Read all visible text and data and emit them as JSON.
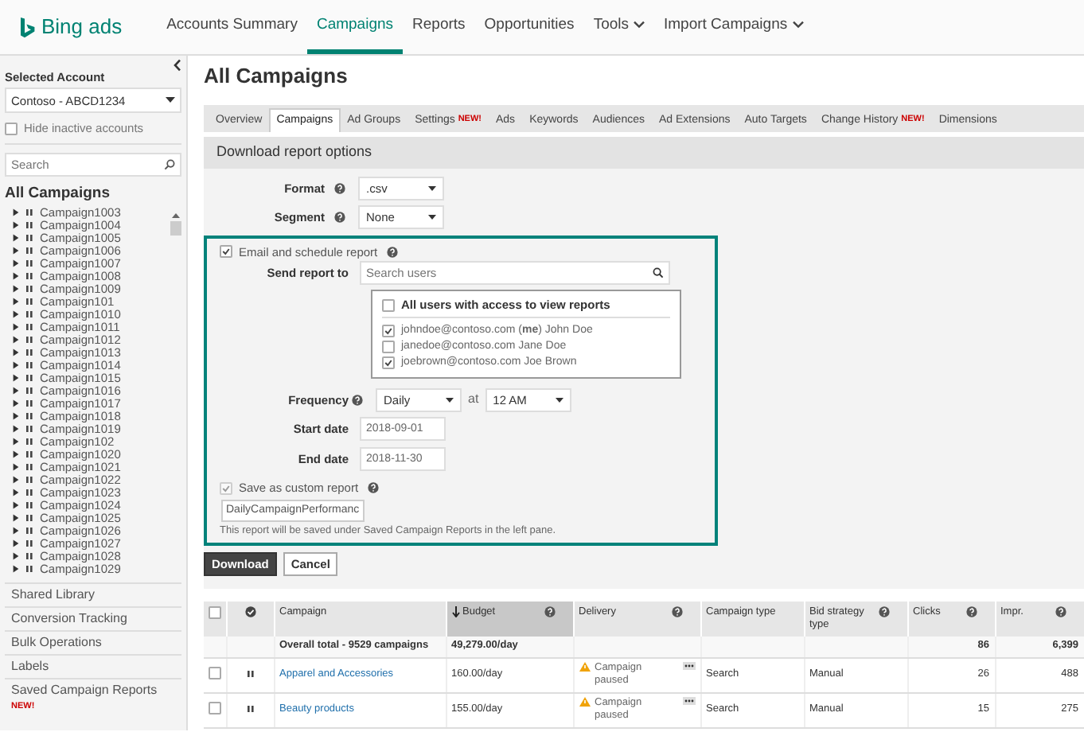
{
  "top_nav": {
    "logo": "Bing ads",
    "items": [
      {
        "label": "Accounts Summary",
        "selected": false,
        "dropdown": false
      },
      {
        "label": "Campaigns",
        "selected": true,
        "dropdown": false
      },
      {
        "label": "Reports",
        "selected": false,
        "dropdown": false
      },
      {
        "label": "Opportunities",
        "selected": false,
        "dropdown": false
      },
      {
        "label": "Tools",
        "selected": false,
        "dropdown": true
      },
      {
        "label": "Import Campaigns",
        "selected": false,
        "dropdown": true
      }
    ]
  },
  "sidebar": {
    "account_label": "Selected Account",
    "account": "Contoso - ABCD1234",
    "hide_inactive": {
      "label": "Hide inactive accounts",
      "checked": false
    },
    "search": {
      "placeholder": "Search"
    },
    "tree_title": "All Campaigns",
    "campaigns": [
      "Campaign1003",
      "Campaign1004",
      "Campaign1005",
      "Campaign1006",
      "Campaign1007",
      "Campaign1008",
      "Campaign1009",
      "Campaign101",
      "Campaign1010",
      "Campaign1011",
      "Campaign1012",
      "Campaign1013",
      "Campaign1014",
      "Campaign1015",
      "Campaign1016",
      "Campaign1017",
      "Campaign1018",
      "Campaign1019",
      "Campaign102",
      "Campaign1020",
      "Campaign1021",
      "Campaign1022",
      "Campaign1023",
      "Campaign1024",
      "Campaign1025",
      "Campaign1026",
      "Campaign1027",
      "Campaign1028",
      "Campaign1029"
    ],
    "links": [
      {
        "label": "Shared Library"
      },
      {
        "label": "Conversion Tracking"
      },
      {
        "label": "Bulk Operations"
      },
      {
        "label": "Labels"
      },
      {
        "label": "Saved Campaign Reports",
        "badge": "NEW!"
      }
    ]
  },
  "page_title": "All Campaigns",
  "tabs": [
    {
      "label": "Overview",
      "selected": false
    },
    {
      "label": "Campaigns",
      "selected": true
    },
    {
      "label": "Ad Groups",
      "selected": false
    },
    {
      "label": "Settings",
      "selected": false,
      "badge": "NEW!"
    },
    {
      "label": "Ads",
      "selected": false
    },
    {
      "label": "Keywords",
      "selected": false
    },
    {
      "label": "Audiences",
      "selected": false
    },
    {
      "label": "Ad Extensions",
      "selected": false
    },
    {
      "label": "Auto Targets",
      "selected": false
    },
    {
      "label": "Change History",
      "selected": false,
      "badge": "NEW!"
    },
    {
      "label": "Dimensions",
      "selected": false
    }
  ],
  "report": {
    "title": "Download report options",
    "format": {
      "label": "Format",
      "value": ".csv"
    },
    "segment": {
      "label": "Segment",
      "value": "None"
    },
    "email": {
      "label": "Email and schedule report",
      "checked": true,
      "send_to_label": "Send report to",
      "search_placeholder": "Search users",
      "all_users": {
        "label": "All users with access to view reports",
        "checked": false
      },
      "users": [
        {
          "text": "johndoe@contoso.com (**me**) John Doe",
          "checked": true
        },
        {
          "text": "janedoe@contoso.com Jane Doe",
          "checked": false
        },
        {
          "text": "joebrown@contoso.com Joe Brown",
          "checked": true
        }
      ],
      "frequency": {
        "label": "Frequency",
        "value": "Daily",
        "at": "at",
        "time": "12 AM"
      },
      "start_date": {
        "label": "Start date",
        "value": "2018-09-01"
      },
      "end_date": {
        "label": "End date",
        "value": "2018-11-30"
      },
      "save_custom": {
        "label": "Save as custom report",
        "checked": true,
        "disabled": true,
        "name": "DailyCampaignPerformanc",
        "note": "This report will be saved under Saved Campaign Reports in the left pane."
      }
    },
    "buttons": [
      "Download",
      "Cancel"
    ]
  },
  "table": {
    "header_checked": false,
    "columns": [
      {
        "label": "Campaign",
        "help": false,
        "sorted": false
      },
      {
        "label": "Budget",
        "help": true,
        "sorted": true
      },
      {
        "label": "Delivery",
        "help": true,
        "sorted": false
      },
      {
        "label": "Campaign type",
        "help": false,
        "sorted": false
      },
      {
        "label": "Bid strategy type",
        "help": true,
        "sorted": false
      },
      {
        "label": "Clicks",
        "help": true,
        "sorted": false
      },
      {
        "label": "Impr.",
        "help": true,
        "sorted": false
      }
    ],
    "total": {
      "label": "Overall total - 9529 campaigns",
      "budget": "49,279.00/day",
      "clicks": "86",
      "impressions": "6,399"
    },
    "rows": [
      {
        "checked": false,
        "campaign": "Apparel and Accessories",
        "budget": "160.00/day",
        "delivery": "Campaign paused",
        "type": "Search",
        "bid_strategy": "Manual",
        "clicks": "26",
        "impressions": "488"
      },
      {
        "checked": false,
        "campaign": "Beauty products",
        "budget": "155.00/day",
        "delivery": "Campaign paused",
        "type": "Search",
        "bid_strategy": "Manual",
        "clicks": "15",
        "impressions": "275"
      }
    ]
  }
}
